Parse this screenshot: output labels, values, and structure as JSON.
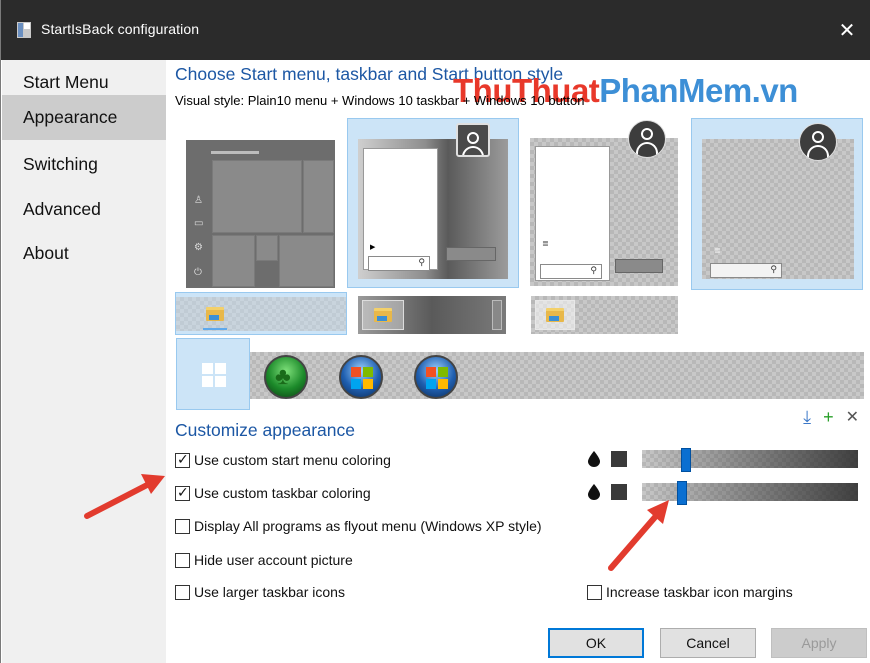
{
  "window": {
    "title": "StartIsBack configuration",
    "close_glyph": "✕"
  },
  "sidebar": {
    "items": [
      {
        "label": "Start Menu"
      },
      {
        "label": "Appearance"
      },
      {
        "label": "Switching"
      },
      {
        "label": "Advanced"
      },
      {
        "label": "About"
      }
    ],
    "active_index": 1
  },
  "main": {
    "heading": "Choose Start menu, taskbar and Start button style",
    "visual_style": "Visual style:  Plain10 menu + Windows 10 taskbar + Windows 10 button",
    "watermark_part1": "ThuThuat",
    "watermark_part2": "PhanMem.vn",
    "customize_heading": "Customize appearance",
    "toolbar": {
      "download_glyph": "⤓",
      "add_glyph": "+",
      "remove_glyph": "✕"
    },
    "options": [
      {
        "label": "Use custom start menu coloring",
        "checked": true
      },
      {
        "label": "Use custom taskbar coloring",
        "checked": true
      },
      {
        "label": "Display All programs as flyout menu (Windows XP style)",
        "checked": false
      },
      {
        "label": "Hide user account picture",
        "checked": false
      },
      {
        "label": "Use larger taskbar icons",
        "checked": false
      }
    ],
    "increase_margins": {
      "label": "Increase taskbar icon margins",
      "checked": false
    },
    "sliders": [
      {
        "name": "start-menu-opacity",
        "value_fraction": 0.2
      },
      {
        "name": "taskbar-opacity",
        "value_fraction": 0.18
      }
    ],
    "drop_glyph": "⬤"
  },
  "buttons": {
    "ok": "OK",
    "cancel": "Cancel",
    "apply": "Apply"
  },
  "colors": {
    "accent_blue": "#1c57a4",
    "selected_tile_bg": "#cce4f7",
    "slider_thumb": "#0a6fd1",
    "arrow_red": "#e23b2e"
  }
}
